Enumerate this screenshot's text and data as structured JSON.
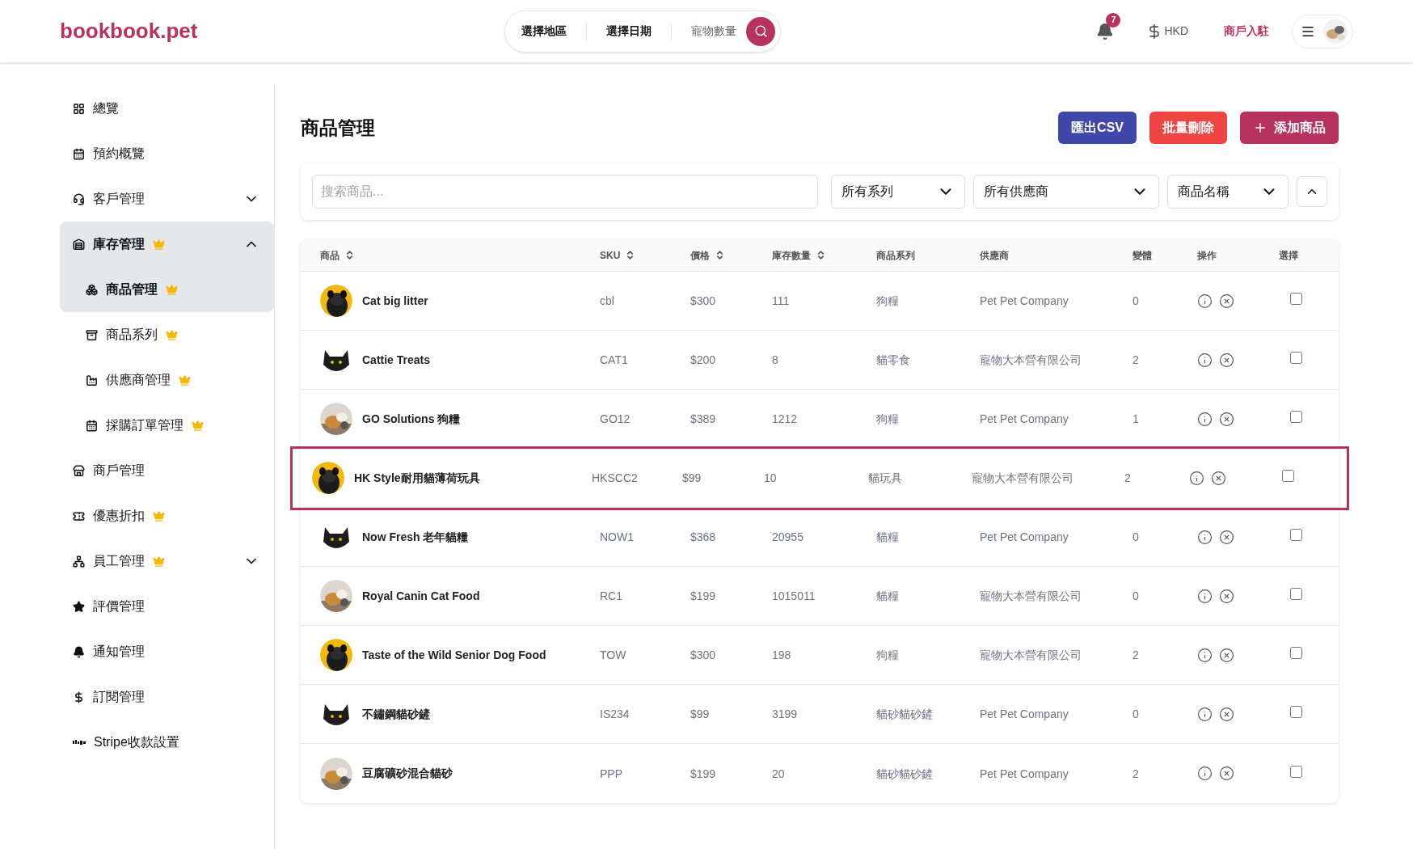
{
  "header": {
    "logo": "bookbook.pet",
    "search_pill": {
      "segments": [
        {
          "label": "選擇地區",
          "kind": "filled"
        },
        {
          "label": "選擇日期",
          "kind": "filled"
        },
        {
          "label": "寵物數量",
          "kind": "hint"
        }
      ]
    },
    "notifications": {
      "count": "7"
    },
    "currency": "HKD",
    "merchant_link": "商戶入駐"
  },
  "sidebar": {
    "items": [
      {
        "label": "總覽",
        "premium": false,
        "selected": false
      },
      {
        "label": "預約概覽",
        "premium": false,
        "selected": false
      },
      {
        "label": "客戶管理",
        "premium": false,
        "selected": false,
        "expanded": false
      },
      {
        "label": "庫存管理",
        "premium": true,
        "selected": true,
        "expanded": true,
        "children": [
          {
            "label": "商品管理",
            "premium": true,
            "selected": true
          },
          {
            "label": "商品系列",
            "premium": true,
            "selected": false
          },
          {
            "label": "供應商管理",
            "premium": true,
            "selected": false
          },
          {
            "label": "採購訂單管理",
            "premium": true,
            "selected": false
          }
        ]
      },
      {
        "label": "商戶管理",
        "premium": false,
        "selected": false
      },
      {
        "label": "優惠折扣",
        "premium": true,
        "selected": false
      },
      {
        "label": "員工管理",
        "premium": true,
        "selected": false,
        "expanded": false
      },
      {
        "label": "評價管理",
        "premium": false,
        "selected": false
      },
      {
        "label": "通知管理",
        "premium": false,
        "selected": false
      },
      {
        "label": "訂閱管理",
        "premium": false,
        "selected": false
      },
      {
        "label": "Stripe收款設置",
        "premium": false,
        "selected": false
      }
    ]
  },
  "page": {
    "title": "商品管理",
    "buttons": [
      {
        "label": "匯出CSV",
        "kind": "export"
      },
      {
        "label": "批量刪除",
        "kind": "delete"
      },
      {
        "label": "添加商品",
        "kind": "add"
      }
    ]
  },
  "filters": {
    "search": {
      "placeholder": "搜索商品..."
    },
    "selects": [
      {
        "value": "所有系列"
      },
      {
        "value": "所有供應商"
      },
      {
        "value": "商品名稱"
      }
    ]
  },
  "table": {
    "columns": [
      {
        "label": "商品",
        "sortable": true
      },
      {
        "label": "SKU",
        "sortable": true
      },
      {
        "label": "價格",
        "sortable": true
      },
      {
        "label": "庫存數量",
        "sortable": true
      },
      {
        "label": "商品系列",
        "sortable": false
      },
      {
        "label": "供應商",
        "sortable": false
      },
      {
        "label": "變體",
        "sortable": false
      },
      {
        "label": "操作",
        "sortable": false
      },
      {
        "label": "選擇",
        "sortable": false
      }
    ],
    "rows": [
      {
        "name": "Cat big litter",
        "sku": "cbl",
        "price": "$300",
        "stock": "111",
        "series": "狗糧",
        "supplier": "Pet Pet Company",
        "variants": "0",
        "checked": false,
        "highlighted": false
      },
      {
        "name": "Cattie Treats",
        "sku": "CAT1",
        "price": "$200",
        "stock": "8",
        "series": "貓零食",
        "supplier": "寵物大本營有限公司",
        "variants": "2",
        "checked": false,
        "highlighted": false
      },
      {
        "name": "GO Solutions 狗糧",
        "sku": "GO12",
        "price": "$389",
        "stock": "1212",
        "series": "狗糧",
        "supplier": "Pet Pet Company",
        "variants": "1",
        "checked": false,
        "highlighted": false
      },
      {
        "name": "HK Style耐用貓薄荷玩具",
        "sku": "HKSCC2",
        "price": "$99",
        "stock": "10",
        "series": "貓玩具",
        "supplier": "寵物大本營有限公司",
        "variants": "2",
        "checked": false,
        "highlighted": true
      },
      {
        "name": "Now Fresh 老年貓糧",
        "sku": "NOW1",
        "price": "$368",
        "stock": "20955",
        "series": "貓糧",
        "supplier": "Pet Pet Company",
        "variants": "0",
        "checked": false,
        "highlighted": false
      },
      {
        "name": "Royal Canin Cat Food",
        "sku": "RC1",
        "price": "$199",
        "stock": "1015011",
        "series": "貓糧",
        "supplier": "寵物大本營有限公司",
        "variants": "0",
        "checked": false,
        "highlighted": false
      },
      {
        "name": "Taste of the Wild Senior Dog Food",
        "sku": "TOW",
        "price": "$300",
        "stock": "198",
        "series": "狗糧",
        "supplier": "寵物大本營有限公司",
        "variants": "2",
        "checked": false,
        "highlighted": false
      },
      {
        "name": "不鏽鋼貓砂鏟",
        "sku": "IS234",
        "price": "$99",
        "stock": "3199",
        "series": "貓砂貓砂鏟",
        "supplier": "Pet Pet Company",
        "variants": "0",
        "checked": false,
        "highlighted": false
      },
      {
        "name": "豆腐礦砂混合貓砂",
        "sku": "PPP",
        "price": "$199",
        "stock": "20",
        "series": "貓砂貓砂鏟",
        "supplier": "Pet Pet Company",
        "variants": "2",
        "checked": false,
        "highlighted": false
      }
    ]
  }
}
